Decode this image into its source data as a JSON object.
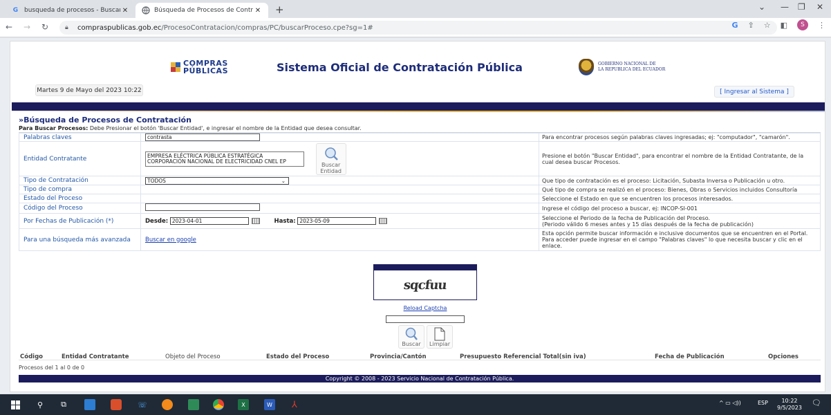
{
  "browser": {
    "tabs": [
      {
        "title": "busqueda de procesos - Buscar c",
        "icon": "google-icon"
      },
      {
        "title": "Búsqueda de Procesos de Contra",
        "icon": "globe-icon"
      }
    ],
    "url_host": "compraspublicas.gob.ec",
    "url_path": "/ProcesoContratacion/compras/PC/buscarProceso.cpe?sg=1#",
    "profile_initial": "S"
  },
  "header": {
    "logo_line1": "COMPRAS",
    "logo_line2": "PÚBLICAS",
    "site_title": "Sistema Oficial de Contratación Pública",
    "gov_line1": "GOBIERNO NACIONAL DE",
    "gov_line2": "LA REPUBLICA DEL ECUADOR",
    "date": "Martes 9 de Mayo del 2023 10:22",
    "login": "[ Ingresar al Sistema ]"
  },
  "search": {
    "title": "»Búsqueda de Procesos de Contratación",
    "instr_bold": "Para Buscar Procesos:",
    "instr_text": "Debe Presionar el botón 'Buscar Entidad', e ingresar el nombre de la Entidad que desea consultar.",
    "rows": {
      "palabras": {
        "label": "Palabras claves",
        "value": "contrasta",
        "help": "Para encontrar procesos según palabras claves ingresadas; ej: \"computador\", \"camarón\"."
      },
      "entidad": {
        "label": "Entidad Contratante",
        "value1": "EMPRESA ELÉCTRICA PÚBLICA ESTRATÉGICA",
        "value2": "CORPORACIÓN NACIONAL DE ELECTRICIDAD CNEL EP",
        "button1": "Buscar",
        "button2": "Entidad",
        "help": "Presione el botón \"Buscar Entidad\", para encontrar el nombre de la Entidad Contratante, de la cual desea buscar Procesos."
      },
      "tipo_contratacion": {
        "label": "Tipo de Contratación",
        "value": "TODOS",
        "help": "Que tipo de contratación es el proceso: Licitación, Subasta Inversa o Publicación u otro."
      },
      "tipo_compra": {
        "label": "Tipo de compra",
        "help": "Qué tipo de compra se realizó en el proceso: Bienes, Obras o Servicios incluidos Consultoría"
      },
      "estado": {
        "label": "Estado del Proceso",
        "help": "Seleccione el Estado en que se encuentren los procesos interesados."
      },
      "codigo": {
        "label": "Código del Proceso",
        "help": "Ingrese el código del proceso a buscar, ej: INCOP-SI-001"
      },
      "fechas": {
        "label": "Por Fechas de Publicación (*)",
        "desde_label": "Desde:",
        "desde": "2023-04-01",
        "hasta_label": "Hasta:",
        "hasta": "2023-05-09",
        "help1": "Seleccione el Periodo de la fecha de Publicación del Proceso.",
        "help2": "(Periodo válido 6 meses antes y 15 días después de la fecha de publicación)"
      },
      "avanzada": {
        "label": "Para una búsqueda más avanzada",
        "link": "Buscar en google",
        "help": "Esta opción permite buscar información e inclusive documentos que se encuentren en el Portal. Para acceder puede ingresar en el campo \"Palabras claves\" lo que necesita buscar y clic en el enlace."
      }
    },
    "captcha_text": "sqcfuu",
    "reload": "Reload Captcha",
    "buscar": "Buscar",
    "limpiar": "Limpiar"
  },
  "results": {
    "columns": [
      "Código",
      "Entidad Contratante",
      "Objeto del Proceso",
      "Estado del Proceso",
      "Provincia/Cantón",
      "Presupuesto Referencial Total(sin iva)",
      "Fecha de Publicación",
      "Opciones"
    ],
    "count": "Procesos del 1 al 0 de 0"
  },
  "footer": "Copyright © 2008 - 2023 Servicio Nacional de Contratación Pública.",
  "taskbar": {
    "lang": "ESP",
    "time": "10:22",
    "date": "9/5/2023",
    "notif": "6"
  },
  "colors": {
    "navy": "#1c1c5c",
    "title": "#1e2d7a",
    "link": "#1a3fb0"
  }
}
